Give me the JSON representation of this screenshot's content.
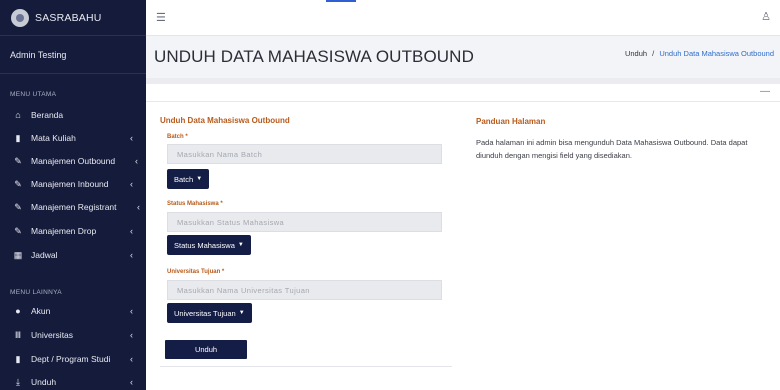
{
  "app": {
    "brand": "SASRABAHU"
  },
  "sidebar": {
    "user": "Admin Testing",
    "section_main": "MENU UTAMA",
    "section_other": "MENU LAINNYA",
    "items_main": [
      {
        "label": "Beranda",
        "icon": "home-icon",
        "chevron": ""
      },
      {
        "label": "Mata Kuliah",
        "icon": "book-icon",
        "chevron": "‹"
      },
      {
        "label": "Manajemen Outbound",
        "icon": "edit-icon",
        "chevron": "‹"
      },
      {
        "label": "Manajemen Inbound",
        "icon": "edit-icon",
        "chevron": "‹"
      },
      {
        "label": "Manajemen Registrant",
        "icon": "edit-icon",
        "chevron": "‹"
      },
      {
        "label": "Manajemen Drop",
        "icon": "edit-icon",
        "chevron": "‹"
      },
      {
        "label": "Jadwal",
        "icon": "calendar-icon",
        "chevron": "‹"
      }
    ],
    "items_other": [
      {
        "label": "Akun",
        "icon": "user-circle-icon",
        "chevron": "‹"
      },
      {
        "label": "Universitas",
        "icon": "university-icon",
        "chevron": "‹"
      },
      {
        "label": "Dept / Program Studi",
        "icon": "building-icon",
        "chevron": "‹"
      },
      {
        "label": "Unduh",
        "icon": "download-icon",
        "chevron": "‹"
      }
    ]
  },
  "header": {
    "title": "UNDUH DATA MAHASISWA OUTBOUND",
    "breadcrumb_root": "Unduh",
    "breadcrumb_sep": "/",
    "breadcrumb_current": "Unduh Data Mahasiswa Outbound"
  },
  "form": {
    "title": "Unduh Data Mahasiswa Outbound",
    "required_mark": "*",
    "batch": {
      "label": "Batch",
      "placeholder": "Masukkan Nama Batch",
      "button": "Batch"
    },
    "status": {
      "label": "Status Mahasiswa",
      "placeholder": "Masukkan Status Mahasiswa",
      "button": "Status Mahasiswa"
    },
    "university": {
      "label": "Universitas Tujuan",
      "placeholder": "Masukkan Nama Universitas Tujuan",
      "button": "Universitas Tujuan"
    },
    "submit": "Unduh"
  },
  "guide": {
    "title": "Panduan Halaman",
    "text": "Pada halaman ini admin bisa mengunduh Data Mahasiswa Outbound. Data dapat diunduh dengan mengisi field yang disediakan."
  },
  "colors": {
    "sidebar": "#151b3a",
    "accent": "#b85a1b",
    "button": "#141d45",
    "link": "#2f6dcf"
  }
}
